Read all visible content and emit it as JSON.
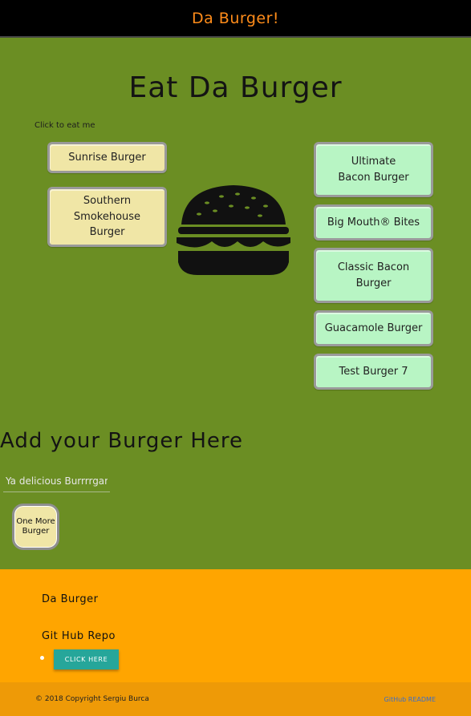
{
  "navbar": {
    "brand": "Da Burger!"
  },
  "main": {
    "title": "Eat Da Burger",
    "hint": "Click to eat me"
  },
  "uneaten_burgers": [
    {
      "name": "Sunrise Burger"
    },
    {
      "name": "Southern Smokehouse Burger"
    }
  ],
  "eaten_burgers": [
    {
      "name": "Ultimate Bacon Burger"
    },
    {
      "name": "Big Mouth® Bites"
    },
    {
      "name": "Classic Bacon Burger"
    },
    {
      "name": "Guacamole Burger"
    },
    {
      "name": "Test Burger 7"
    }
  ],
  "add_form": {
    "title": "Add your Burger Here",
    "placeholder": "Ya delicious Burrrrgar",
    "submit_label": "One More Burger"
  },
  "footer": {
    "brand": "Da Burger",
    "repo_heading": "Git Hub Repo",
    "repo_button": "CLICK HERE",
    "copyright": "© 2018 Copyright Sergiu Burca",
    "github_link": "GitHub README"
  },
  "colors": {
    "page_bg": "#6b8e23",
    "navbar_bg": "#000000",
    "brand": "#ff8c1a",
    "uneaten_bg": "#f0e6a6",
    "eaten_bg": "#b8f5c4",
    "footer_bg": "#ffa500",
    "copyright_bg": "#ee9a07",
    "button_teal": "#26a69a"
  },
  "icons": {
    "burger": "burger-icon"
  }
}
